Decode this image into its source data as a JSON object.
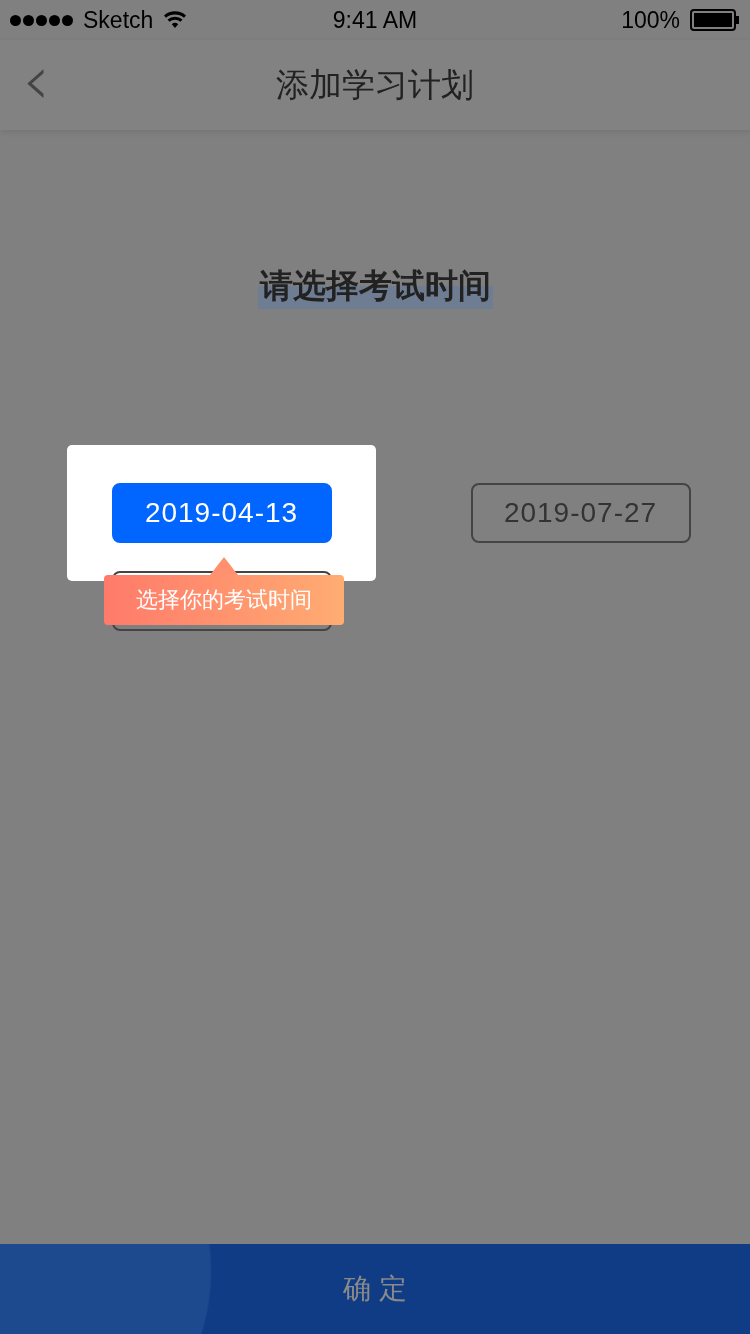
{
  "status_bar": {
    "carrier": "Sketch",
    "time": "9:41 AM",
    "battery": "100%"
  },
  "nav": {
    "back": "‹",
    "title": "添加学习计划"
  },
  "heading": {
    "text": "请选择考试时间",
    "highlighted": true
  },
  "dates": [
    {
      "label": "2019-04-13",
      "selected": true
    },
    {
      "label": "2019-07-27",
      "selected": false
    },
    {
      "selected": false
    }
  ],
  "tooltip": {
    "text": "选择你的考试时间"
  },
  "confirm_button": {
    "label": "确 定"
  }
}
